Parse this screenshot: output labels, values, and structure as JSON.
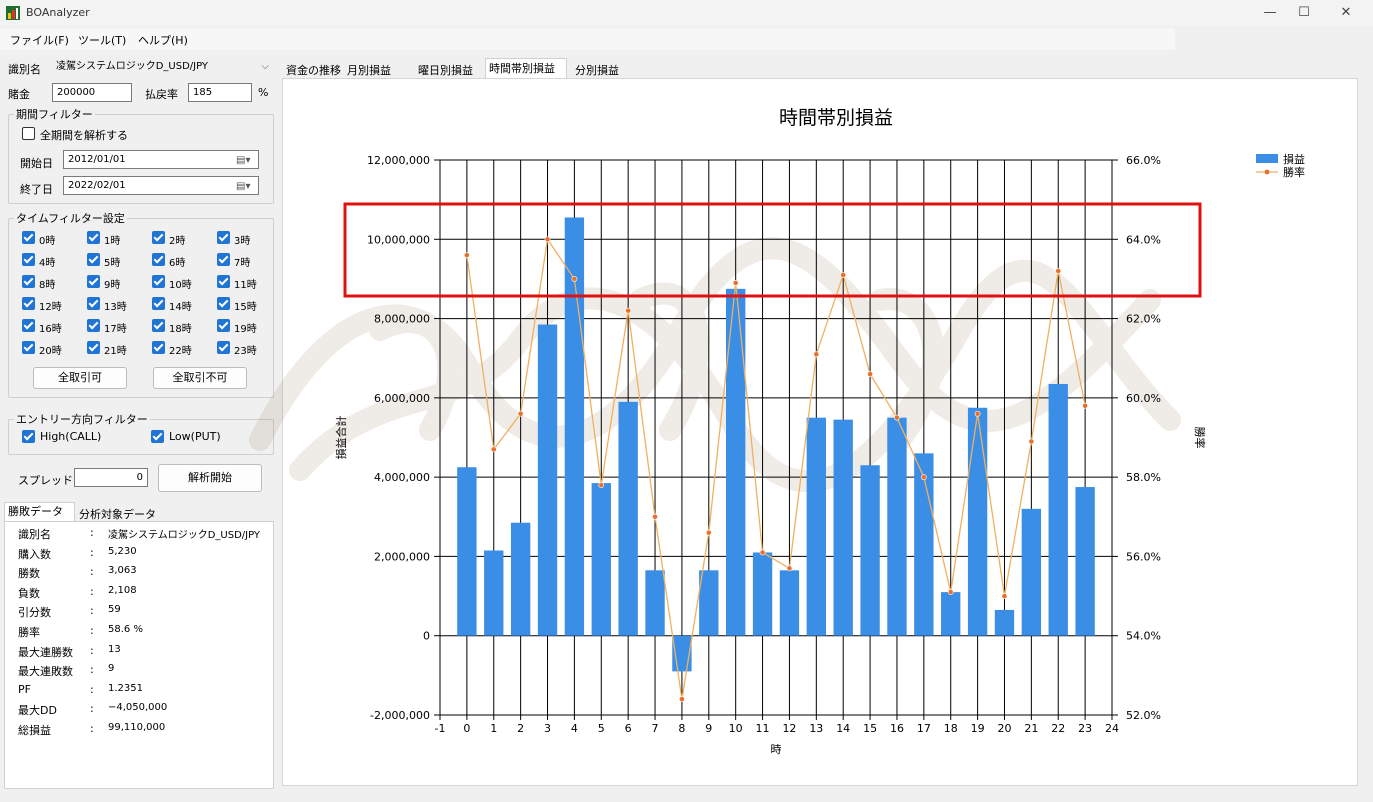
{
  "window": {
    "title": "BOAnalyzer"
  },
  "menu": [
    "ファイル(F)",
    "ツール(T)",
    "ヘルプ(H)"
  ],
  "form": {
    "id_label": "識別名",
    "id_value": "凌駕システムロジックD_USD/JPY",
    "stake_label": "賭金",
    "stake_value": "200000",
    "payout_label": "払戻率",
    "payout_value": "185",
    "percent": "%"
  },
  "period_filter": {
    "title": "期間フィルター",
    "all_label": "全期間を解析する",
    "start_label": "開始日",
    "start_value": "2012/01/01",
    "end_label": "終了日",
    "end_value": "2022/02/01"
  },
  "time_filter": {
    "title": "タイムフィルター設定",
    "hours": [
      "0時",
      "1時",
      "2時",
      "3時",
      "4時",
      "5時",
      "6時",
      "7時",
      "8時",
      "9時",
      "10時",
      "11時",
      "12時",
      "13時",
      "14時",
      "15時",
      "16時",
      "17時",
      "18時",
      "19時",
      "20時",
      "21時",
      "22時",
      "23時"
    ],
    "allow_all": "全取引可",
    "deny_all": "全取引不可"
  },
  "entry_filter": {
    "title": "エントリー方向フィルター",
    "high": "High(CALL)",
    "low": "Low(PUT)"
  },
  "spread": {
    "label": "スプレッド",
    "value": "0",
    "run": "解析開始"
  },
  "data_tabs": [
    "勝敗データ",
    "分析対象データ"
  ],
  "stats": [
    {
      "k": "識別名",
      "v": "凌駕システムロジックD_USD/JPY"
    },
    {
      "k": "購入数",
      "v": "5,230"
    },
    {
      "k": "勝数",
      "v": "3,063"
    },
    {
      "k": "負数",
      "v": "2,108"
    },
    {
      "k": "引分数",
      "v": "59"
    },
    {
      "k": "勝率",
      "v": "58.6 %"
    },
    {
      "k": "最大連勝数",
      "v": "13"
    },
    {
      "k": "最大連敗数",
      "v": "9"
    },
    {
      "k": "PF",
      "v": "1.2351"
    },
    {
      "k": "最大DD",
      "v": "−4,050,000"
    },
    {
      "k": "総損益",
      "v": "99,110,000"
    }
  ],
  "stat_colon": ":",
  "chart_tabs": [
    "資金の推移",
    "月別損益",
    "曜日別損益",
    "時間帯別損益",
    "分別損益"
  ],
  "colors": {
    "bar": "#3a8ee6",
    "line": "#f0b060",
    "marker": "#e8702a",
    "highlight": "#e01010"
  },
  "chart_data": {
    "type": "bar",
    "title": "時間帯別損益",
    "xlabel": "時",
    "ylabel": "損益合計",
    "y2label": "勝率",
    "xlim": [
      -1,
      24
    ],
    "ylim": [
      -2000000,
      12000000
    ],
    "y2lim": [
      52.0,
      66.0
    ],
    "x_ticks": [
      "-1",
      "0",
      "1",
      "2",
      "3",
      "4",
      "5",
      "6",
      "7",
      "8",
      "9",
      "10",
      "11",
      "12",
      "13",
      "14",
      "15",
      "16",
      "17",
      "18",
      "19",
      "20",
      "21",
      "22",
      "23",
      "24"
    ],
    "y_ticks": [
      "-2,000,000",
      "0",
      "2,000,000",
      "4,000,000",
      "6,000,000",
      "8,000,000",
      "10,000,000",
      "12,000,000"
    ],
    "y2_ticks": [
      "52.0%",
      "54.0%",
      "56.0%",
      "58.0%",
      "60.0%",
      "62.0%",
      "64.0%",
      "66.0%"
    ],
    "grid": true,
    "legend_position": "top-right",
    "categories": [
      0,
      1,
      2,
      3,
      4,
      5,
      6,
      7,
      8,
      9,
      10,
      11,
      12,
      13,
      14,
      15,
      16,
      17,
      18,
      19,
      20,
      21,
      22,
      23
    ],
    "series": [
      {
        "name": "損益",
        "type": "bar",
        "values": [
          4250000,
          2150000,
          2850000,
          7850000,
          10550000,
          3850000,
          5900000,
          1650000,
          -900000,
          1650000,
          8750000,
          2100000,
          1650000,
          5500000,
          5450000,
          4300000,
          5500000,
          4600000,
          1100000,
          5750000,
          650000,
          3200000,
          6350000,
          3750000
        ]
      },
      {
        "name": "勝率",
        "type": "line",
        "axis": "y2",
        "values": [
          63.6,
          58.7,
          59.6,
          64.0,
          63.0,
          57.8,
          62.2,
          57.0,
          52.4,
          56.6,
          62.9,
          56.1,
          55.7,
          61.1,
          63.1,
          60.6,
          59.5,
          58.0,
          55.1,
          59.6,
          55.0,
          58.9,
          63.2,
          59.8
        ]
      }
    ]
  }
}
